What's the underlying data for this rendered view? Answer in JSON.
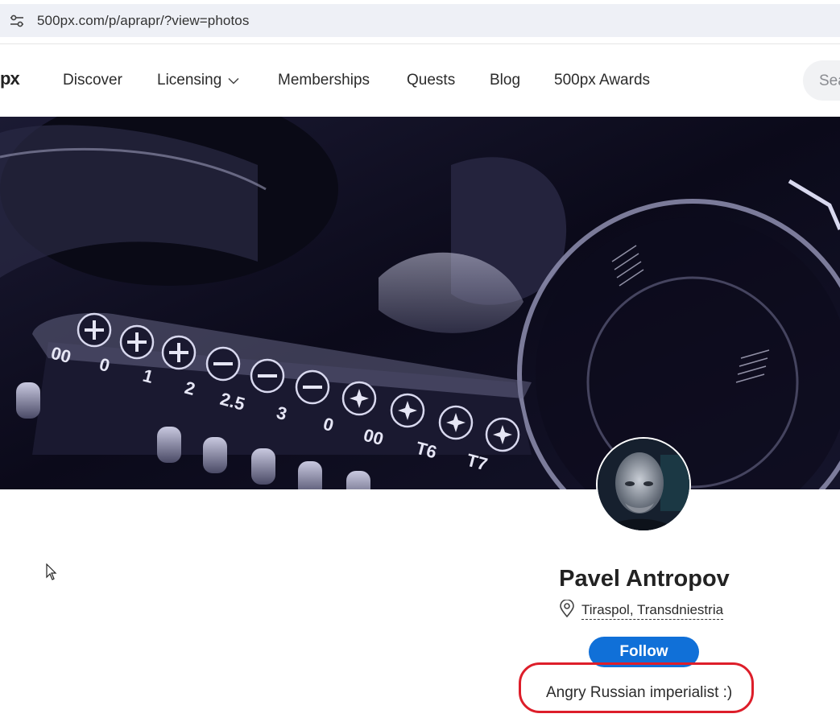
{
  "browser": {
    "url": "500px.com/p/aprapr/?view=photos",
    "site_info_icon": "tune-icon"
  },
  "nav": {
    "logo": "px",
    "items": [
      {
        "label": "Discover"
      },
      {
        "label": "Licensing",
        "icon": "chevron-down-icon"
      },
      {
        "label": "Memberships"
      },
      {
        "label": "Quests"
      },
      {
        "label": "Blog"
      },
      {
        "label": "500px Awards"
      }
    ],
    "search_placeholder": "Sea"
  },
  "cover": {
    "bit_labels": [
      "00",
      "0",
      "1",
      "2",
      "2.5",
      "3",
      "0",
      "00",
      "T6",
      "T7"
    ]
  },
  "profile": {
    "name": "Pavel Antropov",
    "location": "Tiraspol, Transdniestria",
    "location_icon": "map-pin-icon",
    "follow_label": "Follow",
    "bio": "Angry Russian imperialist :)"
  },
  "colors": {
    "accent": "#1070d8",
    "highlight": "#dd1e2a"
  }
}
